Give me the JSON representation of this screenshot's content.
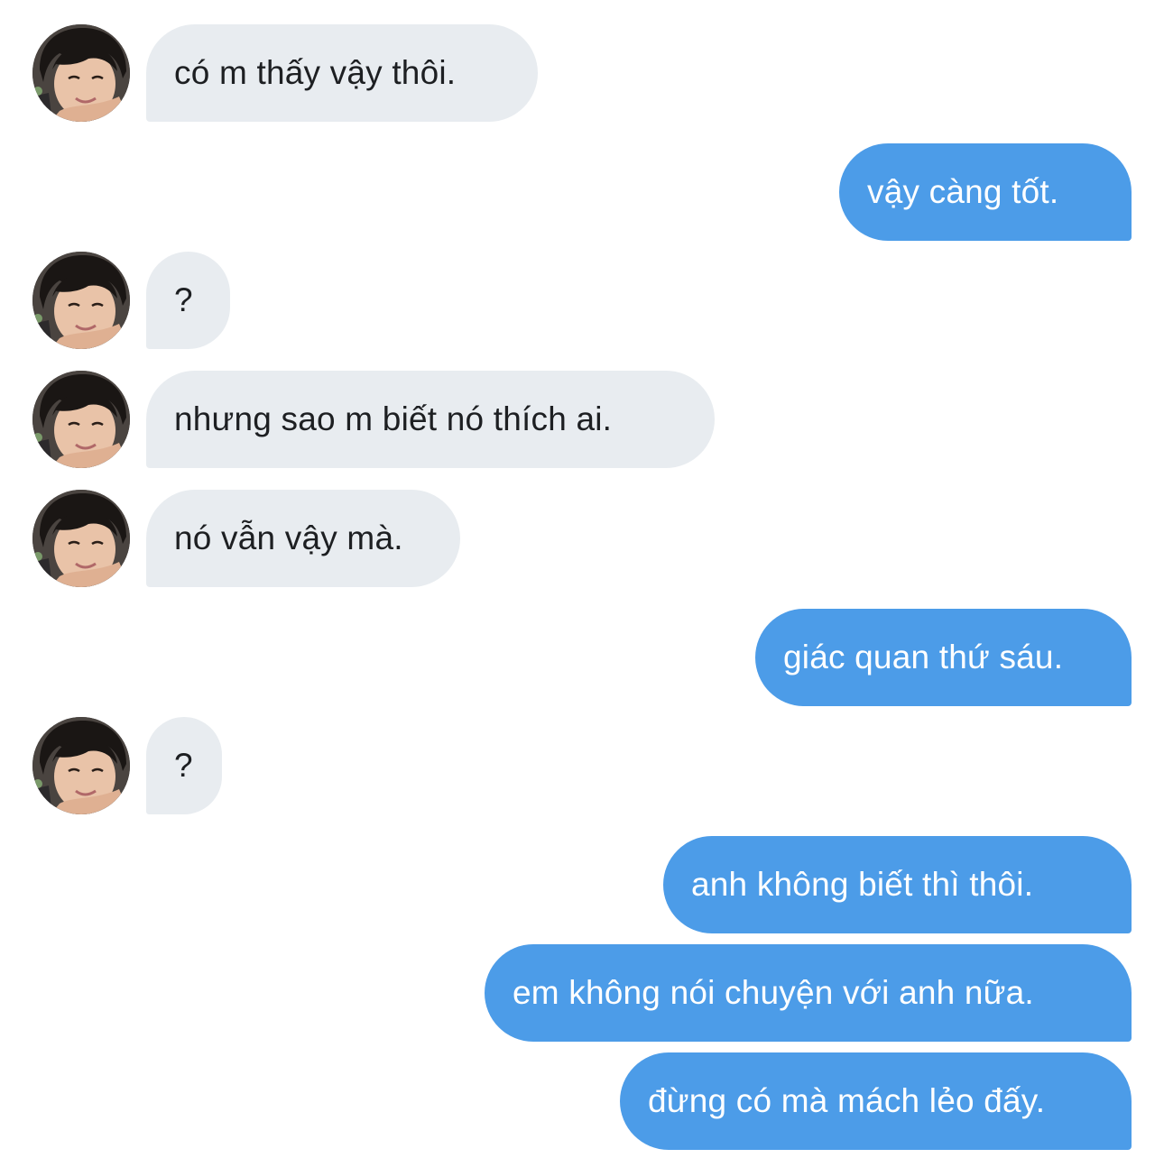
{
  "contact": {
    "avatar_icon": "contact-avatar-photo"
  },
  "colors": {
    "incoming_bubble": "#e8ecf0",
    "outgoing_bubble": "#4c9ce8",
    "incoming_text": "#1d1f22",
    "outgoing_text": "#ffffff"
  },
  "messages": [
    {
      "direction": "incoming",
      "text": "có m thấy vậy thôi."
    },
    {
      "direction": "outgoing",
      "text": "vậy càng tốt."
    },
    {
      "direction": "incoming",
      "text": "?"
    },
    {
      "direction": "incoming",
      "text": "nhưng sao m biết nó thích ai."
    },
    {
      "direction": "incoming",
      "text": "nó vẫn vậy mà."
    },
    {
      "direction": "outgoing",
      "text": "giác quan thứ sáu."
    },
    {
      "direction": "incoming",
      "text": "?"
    },
    {
      "direction": "outgoing",
      "text": "anh không biết thì thôi."
    },
    {
      "direction": "outgoing",
      "text": "em không nói chuyện với anh nữa."
    },
    {
      "direction": "outgoing",
      "text": "đừng có mà mách lẻo đấy."
    }
  ]
}
